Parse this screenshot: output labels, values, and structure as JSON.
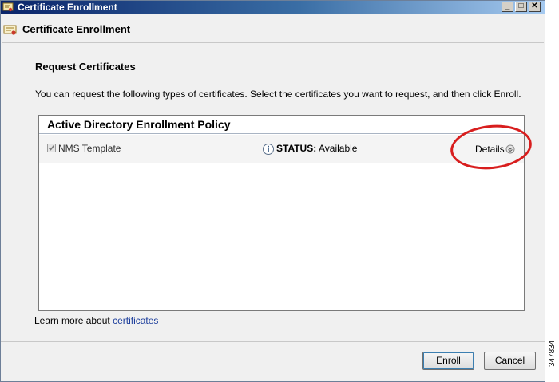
{
  "window": {
    "title": "Certificate Enrollment",
    "controls": {
      "minimize": "_",
      "maximize": "□",
      "close": "✕"
    }
  },
  "header": {
    "title": "Certificate Enrollment",
    "icon": "certificate-icon"
  },
  "main": {
    "section_title": "Request Certificates",
    "instructions": "You can request the following types of certificates. Select the certificates you want to request, and then click Enroll.",
    "policy": {
      "title": "Active Directory Enrollment Policy",
      "items": [
        {
          "name": "NMS Template",
          "checked": true,
          "status_label": "STATUS:",
          "status_value": "Available",
          "details_label": "Details"
        }
      ]
    },
    "learn_more_prefix": "Learn more about ",
    "learn_more_link": "certificates"
  },
  "buttons": {
    "enroll": "Enroll",
    "cancel": "Cancel"
  },
  "figure_number": "347834",
  "colors": {
    "callout": "#d81e1e",
    "link": "#1a3c9b",
    "titlebar": "#0a246a"
  }
}
